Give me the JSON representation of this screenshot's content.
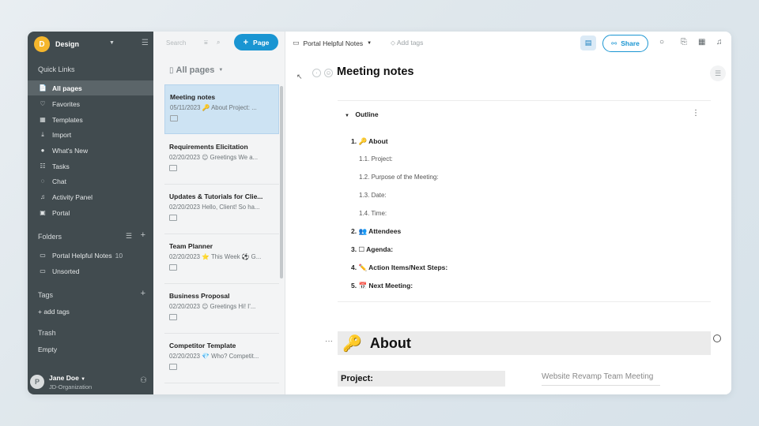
{
  "sidebar": {
    "workspace": {
      "initial": "D",
      "name": "Design"
    },
    "quick_links_title": "Quick Links",
    "items": [
      {
        "label": "All pages",
        "icon": "📄"
      },
      {
        "label": "Favorites",
        "icon": "♡"
      },
      {
        "label": "Templates",
        "icon": "▦"
      },
      {
        "label": "Import",
        "icon": "⤓"
      },
      {
        "label": "What's New",
        "icon": "●"
      },
      {
        "label": "Tasks",
        "icon": "☷"
      },
      {
        "label": "Chat",
        "icon": "◌"
      },
      {
        "label": "Activity Panel",
        "icon": "♫"
      },
      {
        "label": "Portal",
        "icon": "▣"
      }
    ],
    "folders_title": "Folders",
    "folders": [
      {
        "label": "Portal Helpful Notes",
        "count": "10"
      },
      {
        "label": "Unsorted",
        "count": ""
      }
    ],
    "tags_title": "Tags",
    "add_tags": "+ add tags",
    "trash_title": "Trash",
    "trash_empty": "Empty",
    "user": {
      "initial": "P",
      "name": "Jane Doe",
      "org": "JD-Organization"
    }
  },
  "pagelist": {
    "search_placeholder": "Search",
    "new_page": "Page",
    "all_pages": "All pages",
    "cards": [
      {
        "title": "Meeting notes",
        "date": "05/11/2023",
        "emoji": "🔑",
        "snippet": "About Project: ..."
      },
      {
        "title": "Requirements Elicitation",
        "date": "02/20/2023",
        "emoji": "😊",
        "snippet": "Greetings We a..."
      },
      {
        "title": "Updates & Tutorials for Clie...",
        "date": "02/20/2023",
        "emoji": "",
        "snippet": "Hello, Client! So ha..."
      },
      {
        "title": "Team Planner",
        "date": "02/20/2023",
        "emoji": "⭐",
        "snippet": "This Week ⚽ G..."
      },
      {
        "title": "Business Proposal",
        "date": "02/20/2023",
        "emoji": "😊",
        "snippet": "Greetings Hi! I'..."
      },
      {
        "title": "Competitor Template",
        "date": "02/20/2023",
        "emoji": "💎",
        "snippet": "Who? Competit..."
      }
    ]
  },
  "main": {
    "breadcrumb": "Portal Helpful Notes",
    "add_tags": "Add tags",
    "share": "Share",
    "title": "Meeting notes",
    "outline": {
      "heading": "Outline",
      "items": [
        {
          "label": "1. 🔑 About"
        },
        {
          "label": "1.1. Project:"
        },
        {
          "label": "1.2. Purpose of the Meeting:"
        },
        {
          "label": "1.3. Date:"
        },
        {
          "label": "1.4. Time:"
        },
        {
          "label": "2. 👥 Attendees"
        },
        {
          "label": "3. ☐ Agenda:"
        },
        {
          "label": "4. ✏️ Action Items/Next Steps:"
        },
        {
          "label": "5. 📅 Next Meeting:"
        }
      ]
    },
    "about_emoji": "🔑",
    "about_heading": "About",
    "project_label": "Project:",
    "project_value": "Website Revamp Team Meeting"
  },
  "colors": {
    "sidebar_bg": "#414b4f",
    "accent": "#1a95d2",
    "workspace_avatar": "#f5b62c",
    "active_card": "#cde3f3"
  }
}
